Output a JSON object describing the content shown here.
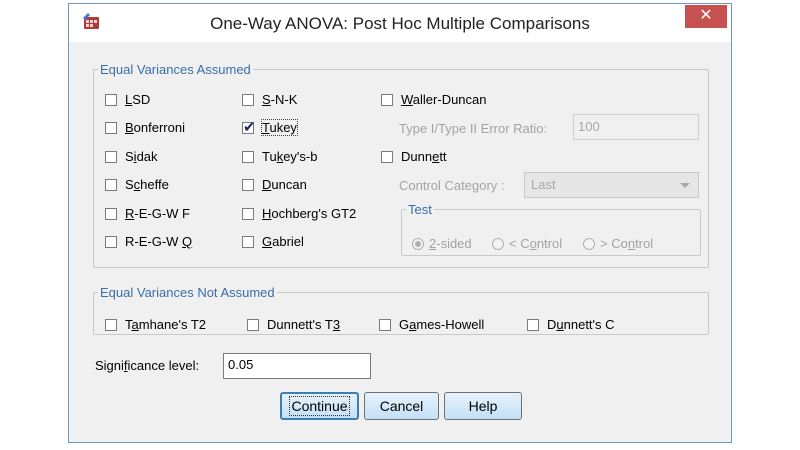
{
  "window": {
    "title": "One-Way ANOVA: Post Hoc Multiple Comparisons",
    "app_icon": "spss-app-icon",
    "close_label": "✕"
  },
  "equal_assumed": {
    "legend": "Equal Variances Assumed",
    "checkboxes": {
      "lsd": {
        "label": "LSD",
        "checked": false
      },
      "bonferroni": {
        "label": "Bonferroni",
        "checked": false
      },
      "sidak": {
        "label": "Sidak",
        "checked": false
      },
      "scheffe": {
        "label": "Scheffe",
        "checked": false
      },
      "regwf": {
        "label": "R-E-G-W F",
        "checked": false
      },
      "regwq": {
        "label": "R-E-G-W Q",
        "checked": false
      },
      "snk": {
        "label": "S-N-K",
        "checked": false
      },
      "tukey": {
        "label": "Tukey",
        "checked": true
      },
      "tukeyb": {
        "label": "Tukey's-b",
        "checked": false
      },
      "duncan": {
        "label": "Duncan",
        "checked": false
      },
      "hochberg": {
        "label": "Hochberg's GT2",
        "checked": false
      },
      "gabriel": {
        "label": "Gabriel",
        "checked": false
      },
      "waller": {
        "label": "Waller-Duncan",
        "checked": false
      },
      "dunnett": {
        "label": "Dunnett",
        "checked": false
      }
    },
    "error_ratio": {
      "label": "Type I/Type II Error Ratio:",
      "value": "100"
    },
    "control_category": {
      "label": "Control Category :",
      "value": "Last"
    },
    "test": {
      "legend": "Test",
      "options": [
        {
          "label": "2-sided",
          "selected": true
        },
        {
          "label": "< Control",
          "selected": false
        },
        {
          "label": "> Control",
          "selected": false
        }
      ]
    }
  },
  "equal_not_assumed": {
    "legend": "Equal Variances Not Assumed",
    "checkboxes": {
      "tamhane": {
        "label": "Tamhane's T2",
        "checked": false
      },
      "dunnett_t3": {
        "label": "Dunnett's T3",
        "checked": false
      },
      "games_howell": {
        "label": "Games-Howell",
        "checked": false
      },
      "dunnett_c": {
        "label": "Dunnett's C",
        "checked": false
      }
    }
  },
  "significance": {
    "label": "Significance level:",
    "value": "0.05"
  },
  "buttons": {
    "continue": "Continue",
    "cancel": "Cancel",
    "help": "Help"
  },
  "colors": {
    "group_legend": "#3a6ea8",
    "close_button": "#c75050",
    "button_border_default": "#3c7fb1"
  }
}
